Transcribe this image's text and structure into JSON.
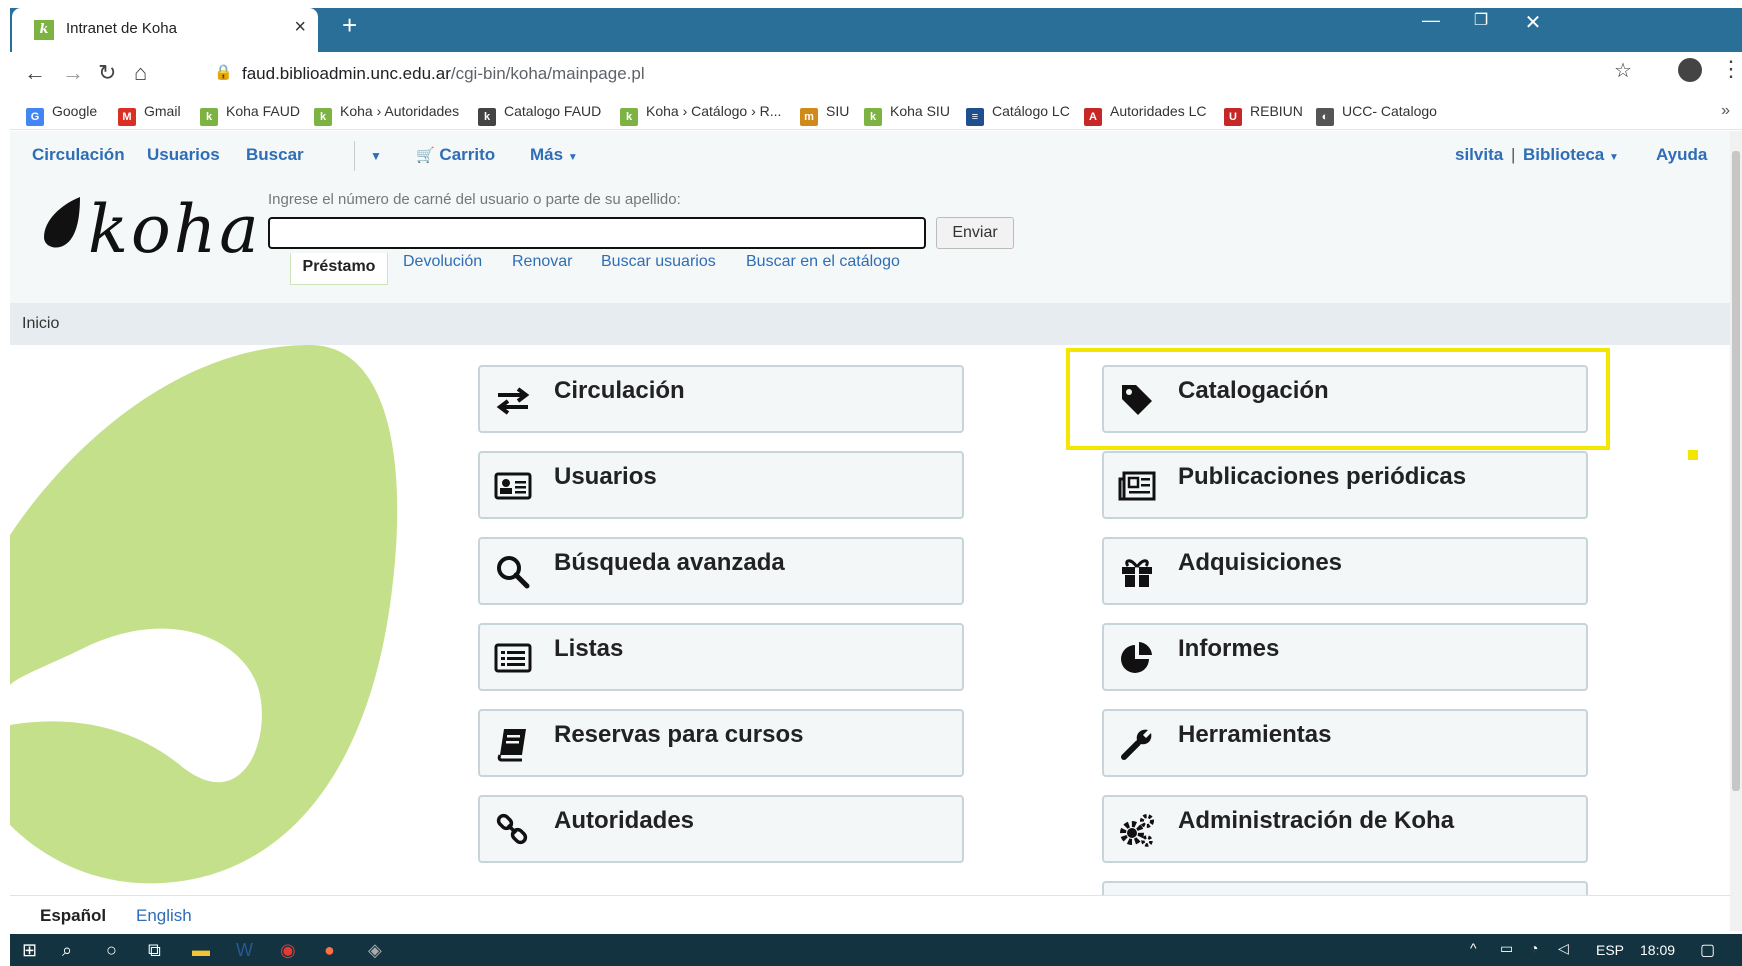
{
  "browser": {
    "tab_title": "Intranet de Koha",
    "tab_close": "×",
    "new_tab": "+",
    "url_host": "faud.biblioadmin.unc.edu.ar",
    "url_path": "/cgi-bin/koha/mainpage.pl",
    "bookmarks": [
      {
        "label": "Google",
        "icon": "google-icon",
        "icon_glyph": "G",
        "color": "#4285f4"
      },
      {
        "label": "Gmail",
        "icon": "gmail-icon",
        "icon_glyph": "M",
        "color": "#d93025"
      },
      {
        "label": "Koha FAUD",
        "icon": "koha-icon",
        "icon_glyph": "k",
        "color": "#7cb342"
      },
      {
        "label": "Koha › Autoridades",
        "icon": "koha-icon",
        "icon_glyph": "k",
        "color": "#7cb342"
      },
      {
        "label": "Catalogo FAUD",
        "icon": "koha-outline-icon",
        "icon_glyph": "k",
        "color": "#444444"
      },
      {
        "label": "Koha › Catálogo › R...",
        "icon": "koha-icon",
        "icon_glyph": "k",
        "color": "#7cb342"
      },
      {
        "label": "SIU",
        "icon": "siu-icon",
        "icon_glyph": "m",
        "color": "#d08a1a"
      },
      {
        "label": "Koha SIU",
        "icon": "koha-icon",
        "icon_glyph": "k",
        "color": "#7cb342"
      },
      {
        "label": "Catálogo LC",
        "icon": "lc-icon",
        "icon_glyph": "≡",
        "color": "#1f4f8f"
      },
      {
        "label": "Autoridades LC",
        "icon": "lc-red-icon",
        "icon_glyph": "A",
        "color": "#c62828"
      },
      {
        "label": "REBIUN",
        "icon": "rebiun-icon",
        "icon_glyph": "U",
        "color": "#c62828"
      },
      {
        "label": "UCC- Catalogo",
        "icon": "globe-icon",
        "icon_glyph": "◐",
        "color": "#555555"
      }
    ],
    "bookmarks_more": "»"
  },
  "koha": {
    "topnav": {
      "circulacion": "Circulación",
      "usuarios": "Usuarios",
      "buscar": "Buscar",
      "carrito": "Carrito",
      "mas": "Más",
      "user": "silvita",
      "sep": "|",
      "biblioteca": "Biblioteca",
      "ayuda": "Ayuda"
    },
    "logo": "koha",
    "search": {
      "label": "Ingrese el número de carné del usuario o parte de su apellido:",
      "value": "",
      "submit": "Enviar",
      "tabs": [
        "Préstamo",
        "Devolución",
        "Renovar",
        "Buscar usuarios",
        "Buscar en el catálogo"
      ]
    },
    "breadcrumb": "Inicio",
    "modules_left": [
      {
        "label": "Circulación",
        "icon": "exchange-icon"
      },
      {
        "label": "Usuarios",
        "icon": "id-card-icon"
      },
      {
        "label": "Búsqueda avanzada",
        "icon": "search-icon"
      },
      {
        "label": "Listas",
        "icon": "list-icon"
      },
      {
        "label": "Reservas para cursos",
        "icon": "book-icon"
      },
      {
        "label": "Autoridades",
        "icon": "link-icon"
      }
    ],
    "modules_right": [
      {
        "label": "Catalogación",
        "icon": "tag-icon"
      },
      {
        "label": "Publicaciones periódicas",
        "icon": "newspaper-icon"
      },
      {
        "label": "Adquisiciones",
        "icon": "gift-icon"
      },
      {
        "label": "Informes",
        "icon": "pie-chart-icon"
      },
      {
        "label": "Herramientas",
        "icon": "wrench-icon"
      },
      {
        "label": "Administración de Koha",
        "icon": "cogs-icon"
      }
    ],
    "languages": [
      "Español",
      "English"
    ],
    "highlight_color": "#f3e600",
    "accent_color": "#2f6db5",
    "blob_color": "#c4e08a"
  },
  "taskbar": {
    "lang": "ESP",
    "time": "18:09"
  }
}
